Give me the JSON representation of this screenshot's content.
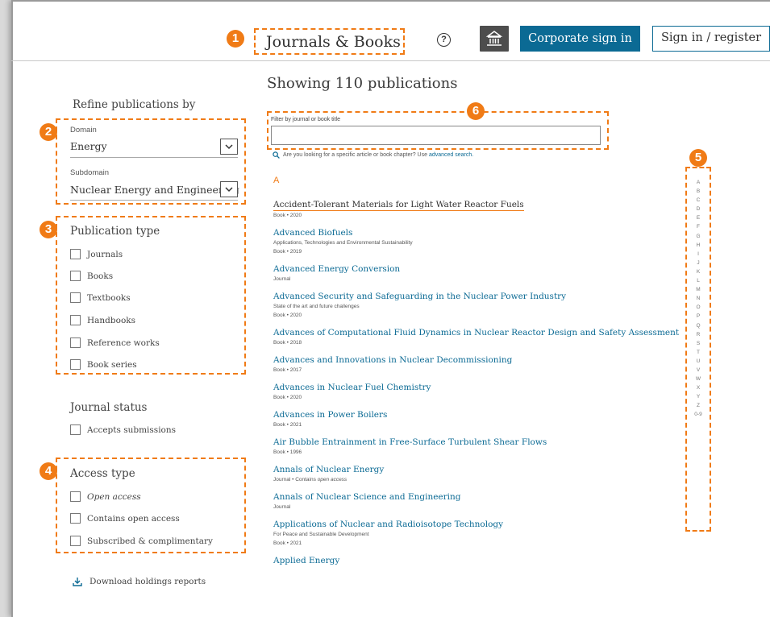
{
  "header": {
    "brand": "Journals & Books",
    "corporate_signin": "Corporate sign in",
    "signin": "Sign in / register",
    "help_symbol": "?",
    "icons": [
      "help-icon",
      "institution-icon"
    ]
  },
  "callouts": [
    "1",
    "2",
    "3",
    "4",
    "5",
    "6"
  ],
  "sidebar": {
    "refine_heading": "Refine publications by",
    "domain_label": "Domain",
    "domain_value": "Energy",
    "subdomain_label": "Subdomain",
    "subdomain_value": "Nuclear Energy and Engineering",
    "pubtype_heading": "Publication type",
    "pubtypes": [
      "Journals",
      "Books",
      "Textbooks",
      "Handbooks",
      "Reference works",
      "Book series"
    ],
    "status_heading": "Journal status",
    "status_option": "Accepts submissions",
    "access_heading": "Access type",
    "access_options": [
      "Open access",
      "Contains open access",
      "Subscribed & complimentary"
    ],
    "download": "Download holdings reports"
  },
  "main": {
    "showing": "Showing 110 publications",
    "filter_label": "Filter by journal or book title",
    "hint_text": "Are you looking for a specific article or book chapter? Use",
    "hint_link": "advanced search.",
    "letter": "A",
    "publications": [
      {
        "title": "Accident-Tolerant Materials for Light Water Reactor Fuels",
        "sub": "",
        "meta": "Book • 2020"
      },
      {
        "title": "Advanced Biofuels",
        "sub": "Applications, Technologies and Environmental Sustainability",
        "meta": "Book • 2019"
      },
      {
        "title": "Advanced Energy Conversion",
        "sub": "",
        "meta": "Journal"
      },
      {
        "title": "Advanced Security and Safeguarding in the Nuclear Power Industry",
        "sub": "State of the art and future challenges",
        "meta": "Book • 2020"
      },
      {
        "title": "Advances of Computational Fluid Dynamics in Nuclear Reactor Design and Safety Assessment",
        "sub": "",
        "meta": "Book • 2018"
      },
      {
        "title": "Advances and Innovations in Nuclear Decommissioning",
        "sub": "",
        "meta": "Book • 2017"
      },
      {
        "title": "Advances in Nuclear Fuel Chemistry",
        "sub": "",
        "meta": "Book • 2020"
      },
      {
        "title": "Advances in Power Boilers",
        "sub": "",
        "meta": "Book • 2021"
      },
      {
        "title": "Air Bubble Entrainment in Free-Surface Turbulent Shear Flows",
        "sub": "",
        "meta": "Book • 1996"
      },
      {
        "title": "Annals of Nuclear Energy",
        "sub": "",
        "meta": "Journal • Contains",
        "meta_em": "open access"
      },
      {
        "title": "Annals of Nuclear Science and Engineering",
        "sub": "",
        "meta": "Journal"
      },
      {
        "title": "Applications of Nuclear and Radioisotope Technology",
        "sub": "For Peace and Sustainable Development",
        "meta": "Book • 2021"
      },
      {
        "title": "Applied Energy",
        "sub": "",
        "meta": ""
      }
    ]
  },
  "alphabet": [
    "A",
    "B",
    "C",
    "D",
    "E",
    "F",
    "G",
    "H",
    "I",
    "J",
    "K",
    "L",
    "M",
    "N",
    "O",
    "P",
    "Q",
    "R",
    "S",
    "T",
    "U",
    "V",
    "W",
    "X",
    "Y",
    "Z",
    "0-9"
  ],
  "colors": {
    "accent": "#f07b16",
    "link": "#0b6a94",
    "dark_button": "#4d4d4d"
  }
}
